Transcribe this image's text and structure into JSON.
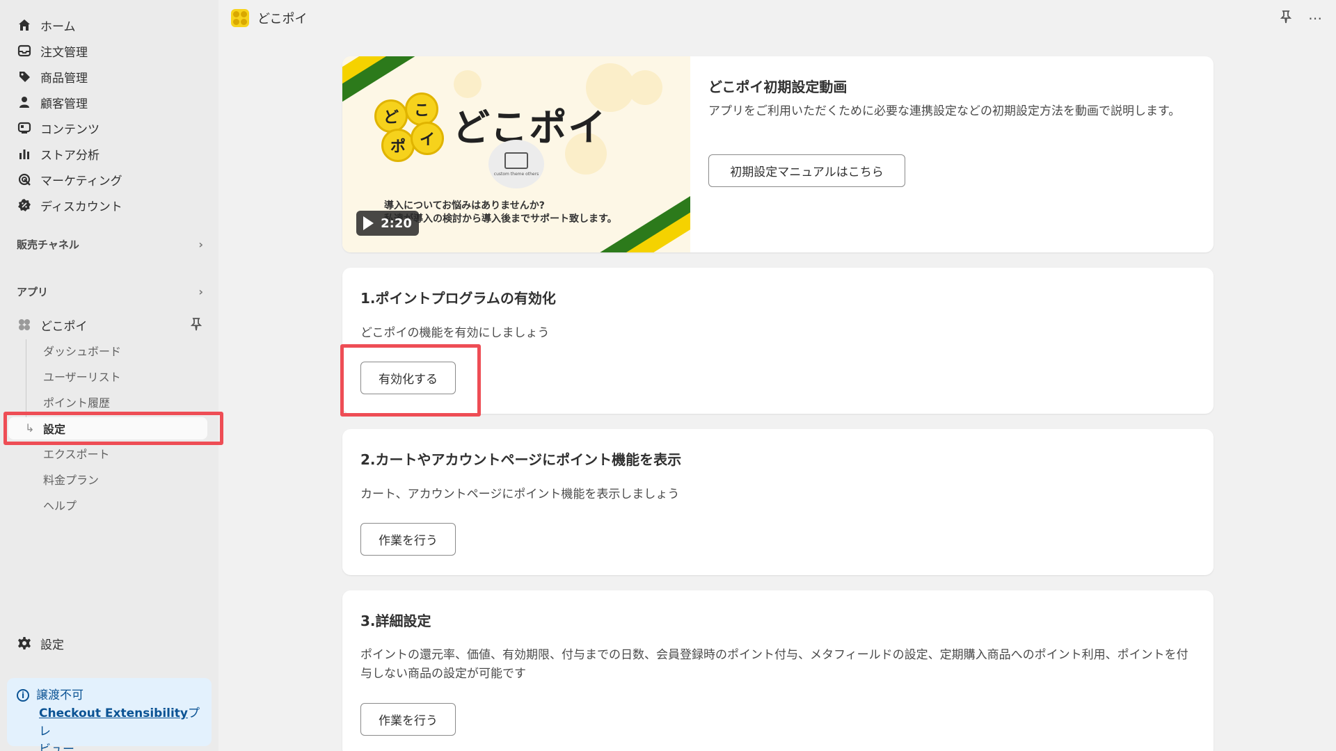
{
  "sidebar": {
    "nav": [
      {
        "label": "ホーム",
        "icon": "home-icon"
      },
      {
        "label": "注文管理",
        "icon": "inbox-icon"
      },
      {
        "label": "商品管理",
        "icon": "tag-icon"
      },
      {
        "label": "顧客管理",
        "icon": "person-icon"
      },
      {
        "label": "コンテンツ",
        "icon": "content-icon"
      },
      {
        "label": "ストア分析",
        "icon": "bar-chart-icon"
      },
      {
        "label": "マーケティング",
        "icon": "target-icon"
      },
      {
        "label": "ディスカウント",
        "icon": "discount-icon"
      }
    ],
    "sales_channels": "販売チャネル",
    "apps": "アプリ",
    "app_name": "どこポイ",
    "sub_items": [
      "ダッシュボード",
      "ユーザーリスト",
      "ポイント履歴",
      "設定",
      "エクスポート",
      "料金プラン",
      "ヘルプ"
    ],
    "settings": "設定",
    "notice": {
      "title": "譲渡不可",
      "link": "Checkout Extensibility",
      "suffix": "プレ",
      "line3": "ビュー"
    }
  },
  "topbar": {
    "title": "どこポイ"
  },
  "video_card": {
    "thumb_title": "どこポイ",
    "thumb_line1": "導入についてお悩みはありませんか?",
    "thumb_line2": "私達が導入の検討から導入後までサポート致します。",
    "thumb_icon_caption": "custom theme others",
    "duration": "2:20",
    "title": "どこポイ初期設定動画",
    "desc": "アプリをご利用いただくために必要な連携設定などの初期設定方法を動画で説明します。",
    "button": "初期設定マニュアルはこちら"
  },
  "step1": {
    "title": "1.ポイントプログラムの有効化",
    "desc": "どこポイの機能を有効にしましょう",
    "button": "有効化する"
  },
  "step2": {
    "title": "2.カートやアカウントページにポイント機能を表示",
    "desc": "カート、アカウントページにポイント機能を表示しましょう",
    "button": "作業を行う"
  },
  "step3": {
    "title": "3.詳細設定",
    "desc": "ポイントの還元率、価値、有効期限、付与までの日数、会員登録時のポイント付与、メタフィールドの設定、定期購入商品へのポイント利用、ポイントを付与しない商品の設定が可能です",
    "button": "作業を行う"
  },
  "colors": {
    "highlight": "#ee4d55",
    "brand_yellow": "#f6d21c",
    "brand_green": "#2c7a1b",
    "link_blue": "#0b5394"
  }
}
